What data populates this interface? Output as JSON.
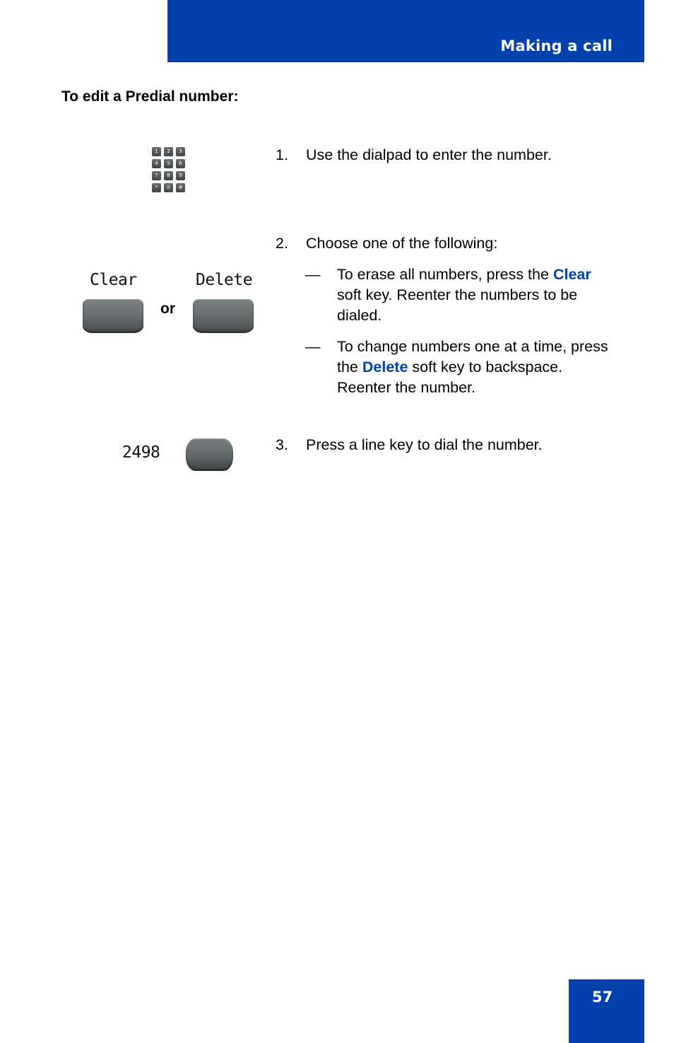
{
  "header": {
    "title": "Making a call"
  },
  "section_title": "To edit a Predial number:",
  "dialpad": {
    "keys": [
      "1",
      "2",
      "3",
      "4",
      "5",
      "6",
      "7",
      "8",
      "9",
      "*",
      "0",
      "#"
    ]
  },
  "steps": [
    {
      "number": "1.",
      "text": "Use the dialpad to enter the number."
    },
    {
      "number": "2.",
      "text": "Choose one of the following:",
      "options": [
        {
          "dash": "—",
          "before": "To erase all numbers, press the ",
          "keyword": "Clear",
          "after": " soft key. Reenter the numbers to be dialed."
        },
        {
          "dash": "—",
          "before": "To change numbers one at a time, press the ",
          "keyword": "Delete",
          "after": " soft key to backspace. Reenter the number."
        }
      ]
    },
    {
      "number": "3.",
      "text": "Press a line key to dial the number."
    }
  ],
  "softkeys": {
    "clear_label": "Clear",
    "delete_label": "Delete",
    "or_label": "or"
  },
  "linekey": {
    "display_number": "2498"
  },
  "footer": {
    "page_number": "57"
  },
  "colors": {
    "brand_blue": "#0041ad"
  }
}
